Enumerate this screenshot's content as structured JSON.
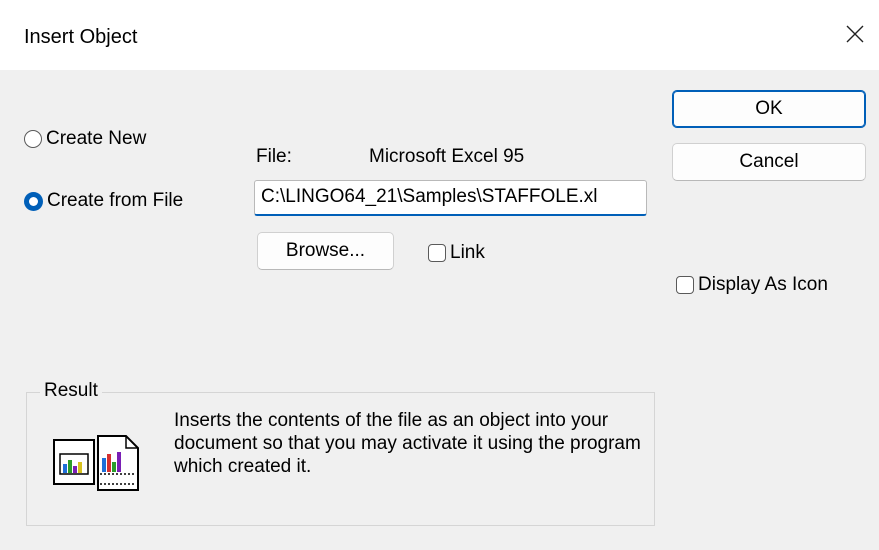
{
  "window": {
    "title": "Insert Object"
  },
  "source_options": {
    "create_new": {
      "label": "Create New",
      "selected": false
    },
    "create_from_file": {
      "label": "Create from File",
      "selected": true
    }
  },
  "file": {
    "label": "File:",
    "type": "Microsoft Excel 95",
    "path_value": "C:\\LINGO64_21\\Samples\\STAFFOLE.xl",
    "browse_label": "Browse...",
    "link_label": "Link",
    "link_checked": false
  },
  "buttons": {
    "ok_label": "OK",
    "cancel_label": "Cancel"
  },
  "display_as_icon": {
    "label": "Display As Icon",
    "checked": false
  },
  "result": {
    "legend": "Result",
    "text": "Inserts the contents of the file as an object into your document so that you may activate it using the program which created it."
  },
  "colors": {
    "accent": "#005fb8",
    "background": "#f0f0f0",
    "titlebar": "#ffffff"
  }
}
